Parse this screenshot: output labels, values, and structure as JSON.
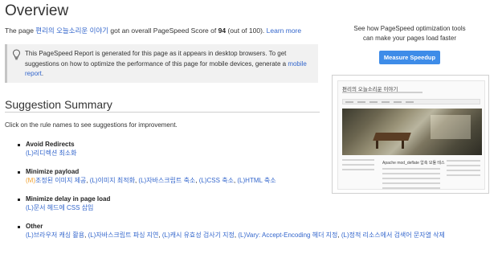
{
  "header": {
    "title": "Overview"
  },
  "score": {
    "prefix": "The page ",
    "page_name": "편리의 오늘소리운 이야기",
    "middle": " got an overall PageSpeed Score of ",
    "value": "94",
    "suffix": " (out of 100). ",
    "learn_more": "Learn more"
  },
  "notice": {
    "icon": "lightbulb-icon",
    "text": "This PageSpeed Report is generated for this page as it appears in desktop browsers. To get suggestions on how to optimize the performance of this page for mobile devices, generate a ",
    "link": "mobile report",
    "end": "."
  },
  "summary": {
    "title": "Suggestion Summary",
    "hint": "Click on the rule names to see suggestions for improvement."
  },
  "rules": [
    {
      "name": "Avoid Redirects",
      "items": [
        {
          "tag": "(L)",
          "level": "L",
          "text": "리디렉션 최소화"
        }
      ]
    },
    {
      "name": "Minimize payload",
      "items": [
        {
          "tag": "(M)",
          "level": "M",
          "text": "조정된 이미지 제공"
        },
        {
          "tag": "(L)",
          "level": "L",
          "text": "이미지 최적화"
        },
        {
          "tag": "(L)",
          "level": "L",
          "text": "자바스크립트 축소"
        },
        {
          "tag": "(L)",
          "level": "L",
          "text": "CSS 축소"
        },
        {
          "tag": "(L)",
          "level": "L",
          "text": "HTML 축소"
        }
      ]
    },
    {
      "name": "Minimize delay in page load",
      "items": [
        {
          "tag": "(L)",
          "level": "L",
          "text": "문서 헤드에 CSS 삽입"
        }
      ]
    },
    {
      "name": "Other",
      "items": [
        {
          "tag": "(L)",
          "level": "L",
          "text": "브라우저 캐싱 활용"
        },
        {
          "tag": "(L)",
          "level": "L",
          "text": "자바스크립트 파싱 지연"
        },
        {
          "tag": "(L)",
          "level": "L",
          "text": "캐시 유효성 검사기 지정"
        },
        {
          "tag": "(L)",
          "level": "L",
          "text": "Vary: Accept-Encoding 헤더 지정"
        },
        {
          "tag": "(L)",
          "level": "L",
          "text": "정적 리소스에서 검색어 문자열 삭제"
        }
      ]
    }
  ],
  "sidebar": {
    "line1": "See how PageSpeed optimization tools",
    "line2": "can make your pages load faster",
    "button": "Measure Speedup"
  },
  "preview": {
    "site_title": "편리의 오늘소리운 이야기",
    "post_heading": "Apache mod_deflate 압축 모듈 테스"
  },
  "colors": {
    "link": "#3366cc",
    "medium_priority": "#f0a030",
    "button": "#3e8ce8"
  }
}
